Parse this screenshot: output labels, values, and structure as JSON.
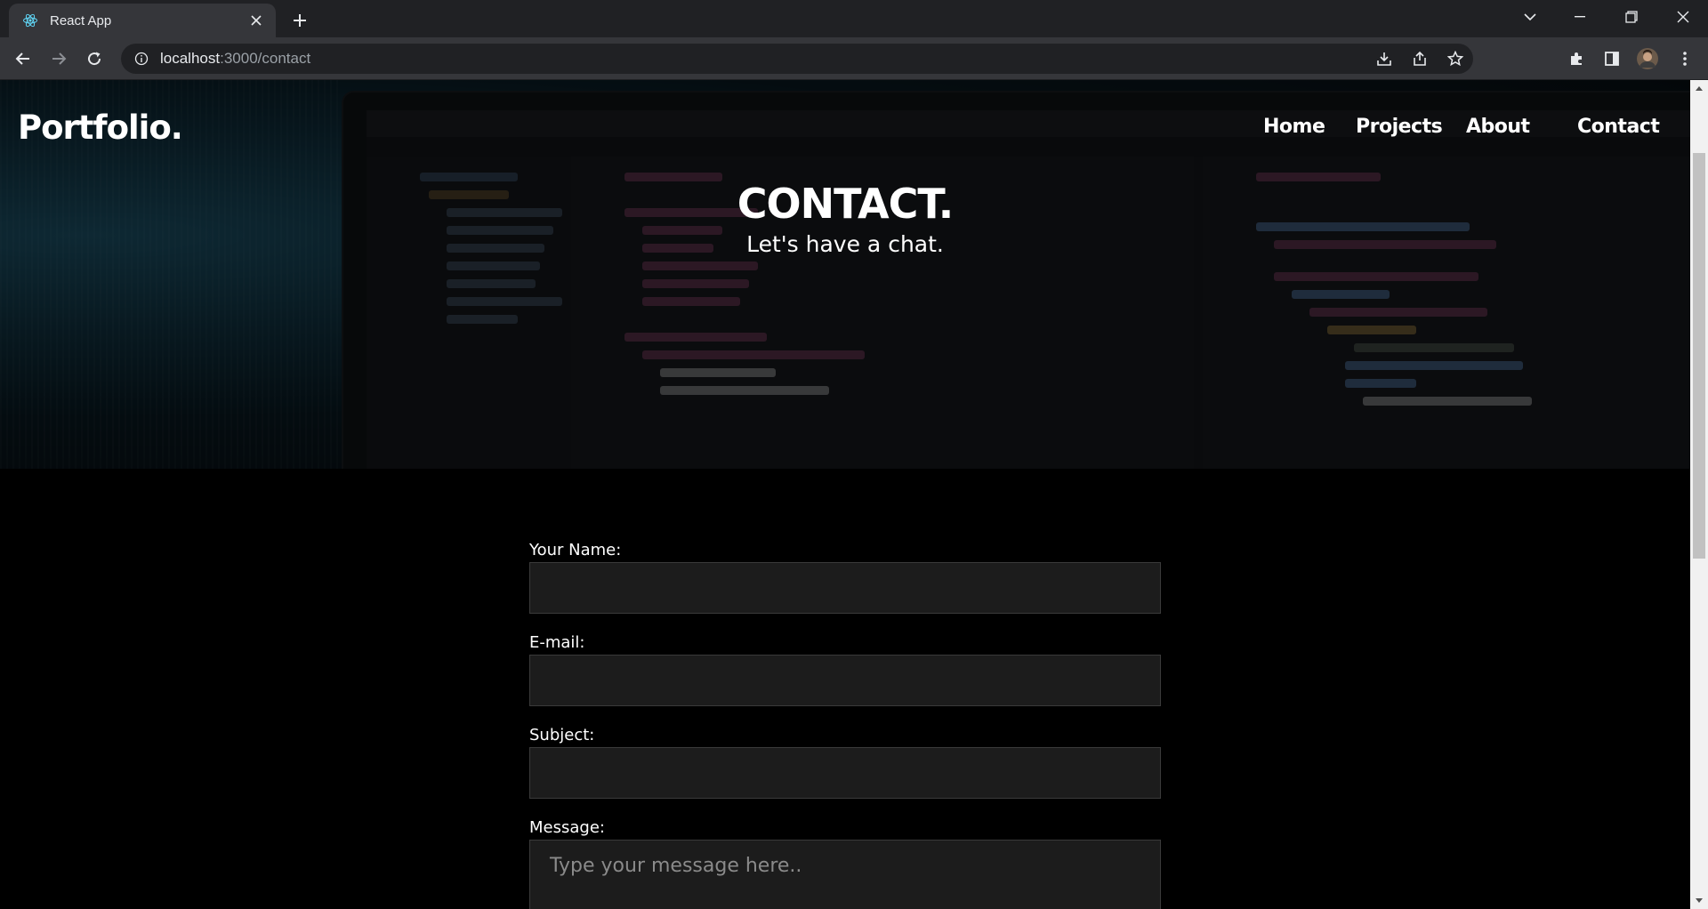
{
  "browser": {
    "tab_title": "React App",
    "url_host": "localhost",
    "url_path": ":3000/contact"
  },
  "site": {
    "brand": "Portfolio.",
    "nav": [
      {
        "label": "Home"
      },
      {
        "label": "Projects"
      },
      {
        "label": "About"
      },
      {
        "label": "Contact"
      }
    ]
  },
  "hero": {
    "title": "CONTACT.",
    "subtitle": "Let's have a chat."
  },
  "form": {
    "name_label": "Your Name:",
    "name_value": "",
    "email_label": "E-mail:",
    "email_value": "",
    "subject_label": "Subject:",
    "subject_value": "",
    "message_label": "Message:",
    "message_placeholder": "Type your message here.."
  },
  "colors": {
    "chrome_dark": "#202124",
    "chrome_toolbar": "#35363a",
    "page_bg": "#000000",
    "input_bg": "#1c1c1c",
    "react_blue": "#61dafb"
  },
  "icons": {
    "favicon": "react-logo-icon",
    "back": "arrow-left-icon",
    "forward": "arrow-right-icon",
    "reload": "reload-icon",
    "info": "info-icon",
    "install": "install-app-icon",
    "share": "share-icon",
    "bookmark": "star-icon",
    "extensions": "puzzle-icon",
    "side_panel": "side-panel-icon",
    "profile": "avatar",
    "menu": "kebab-menu-icon"
  }
}
